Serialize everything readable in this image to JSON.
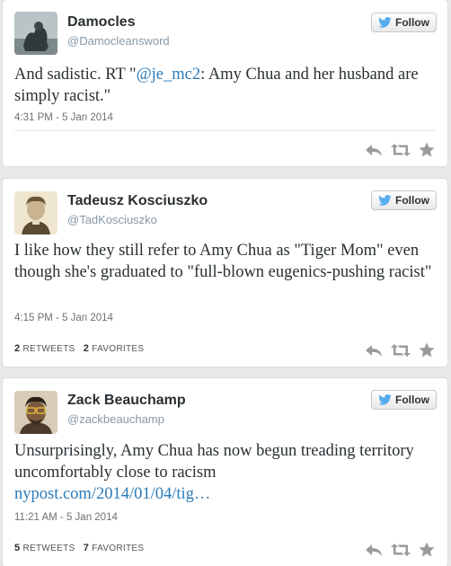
{
  "follow_label": "Follow",
  "colors": {
    "link": "#2b7bb9",
    "twitter_bird": "#55acee",
    "action_icons": "#9b9b9b"
  },
  "tweets": [
    {
      "name": "Damocles",
      "handle": "@Damocleansword",
      "text_before": "And sadistic.  RT \"",
      "mention": "@je_mc2",
      "text_after": ": Amy Chua and her husband are simply racist.\"",
      "timestamp": "4:31 PM - 5 Jan 2014",
      "icons": [
        "reply-icon",
        "retweet-icon",
        "favorite-icon"
      ]
    },
    {
      "name": "Tadeusz Kosciuszko",
      "handle": "@TadKosciuszko",
      "text": "I like how they still refer to Amy Chua as \"Tiger Mom\" even though she's graduated to \"full-blown eugenics-pushing racist\"",
      "timestamp": "4:15 PM - 5 Jan 2014",
      "retweets_count": "2",
      "retweets_label": "RETWEETS",
      "favorites_count": "2",
      "favorites_label": "FAVORITES",
      "icons": [
        "reply-icon",
        "retweet-icon",
        "favorite-icon"
      ]
    },
    {
      "name": "Zack Beauchamp",
      "handle": "@zackbeauchamp",
      "text": "Unsurprisingly, Amy Chua has now begun treading territory uncomfortably close to racism",
      "link": "nypost.com/2014/01/04/tig…",
      "timestamp": "11:21 AM - 5 Jan 2014",
      "retweets_count": "5",
      "retweets_label": "RETWEETS",
      "favorites_count": "7",
      "favorites_label": "FAVORITES",
      "icons": [
        "reply-icon",
        "retweet-icon",
        "favorite-icon"
      ]
    }
  ]
}
